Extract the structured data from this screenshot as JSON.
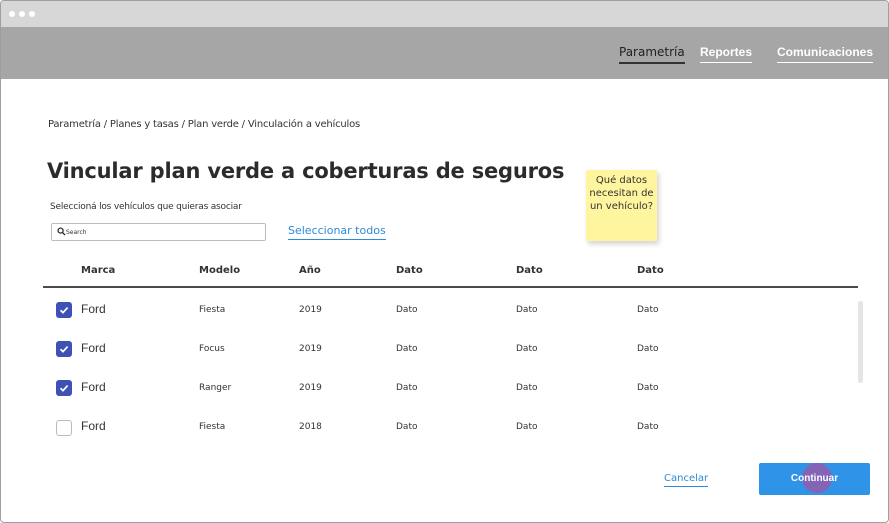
{
  "nav": {
    "items": [
      {
        "label": "Parametría",
        "active": true
      },
      {
        "label": "Reportes",
        "active": false
      },
      {
        "label": "Comunicaciones",
        "active": false
      }
    ]
  },
  "breadcrumb": "Parametría / Planes y tasas / Plan verde / Vinculación a vehículos",
  "page_title": "Vincular plan verde a coberturas de seguros",
  "subtitle": "Seleccioná los vehículos que quieras asociar",
  "search": {
    "placeholder": "Search",
    "value": ""
  },
  "select_all_label": "Seleccionar todos",
  "sticky_note": "Qué datos necesitan de un vehículo?",
  "table": {
    "headers": [
      "Marca",
      "Modelo",
      "Año",
      "Dato",
      "Dato",
      "Dato"
    ],
    "rows": [
      {
        "checked": true,
        "cells": [
          "Ford",
          "Fiesta",
          "2019",
          "Dato",
          "Dato",
          "Dato"
        ]
      },
      {
        "checked": true,
        "cells": [
          "Ford",
          "Focus",
          "2019",
          "Dato",
          "Dato",
          "Dato"
        ]
      },
      {
        "checked": true,
        "cells": [
          "Ford",
          "Ranger",
          "2019",
          "Dato",
          "Dato",
          "Dato"
        ]
      },
      {
        "checked": false,
        "cells": [
          "Ford",
          "Fiesta",
          "2018",
          "Dato",
          "Dato",
          "Dato"
        ]
      }
    ]
  },
  "actions": {
    "cancel_label": "Cancelar",
    "continue_label": "Continuar"
  },
  "colors": {
    "accent": "#2f94e8",
    "checkbox": "#3f51b5",
    "navbar": "#a6a6a6",
    "sticky": "#fff59e"
  }
}
